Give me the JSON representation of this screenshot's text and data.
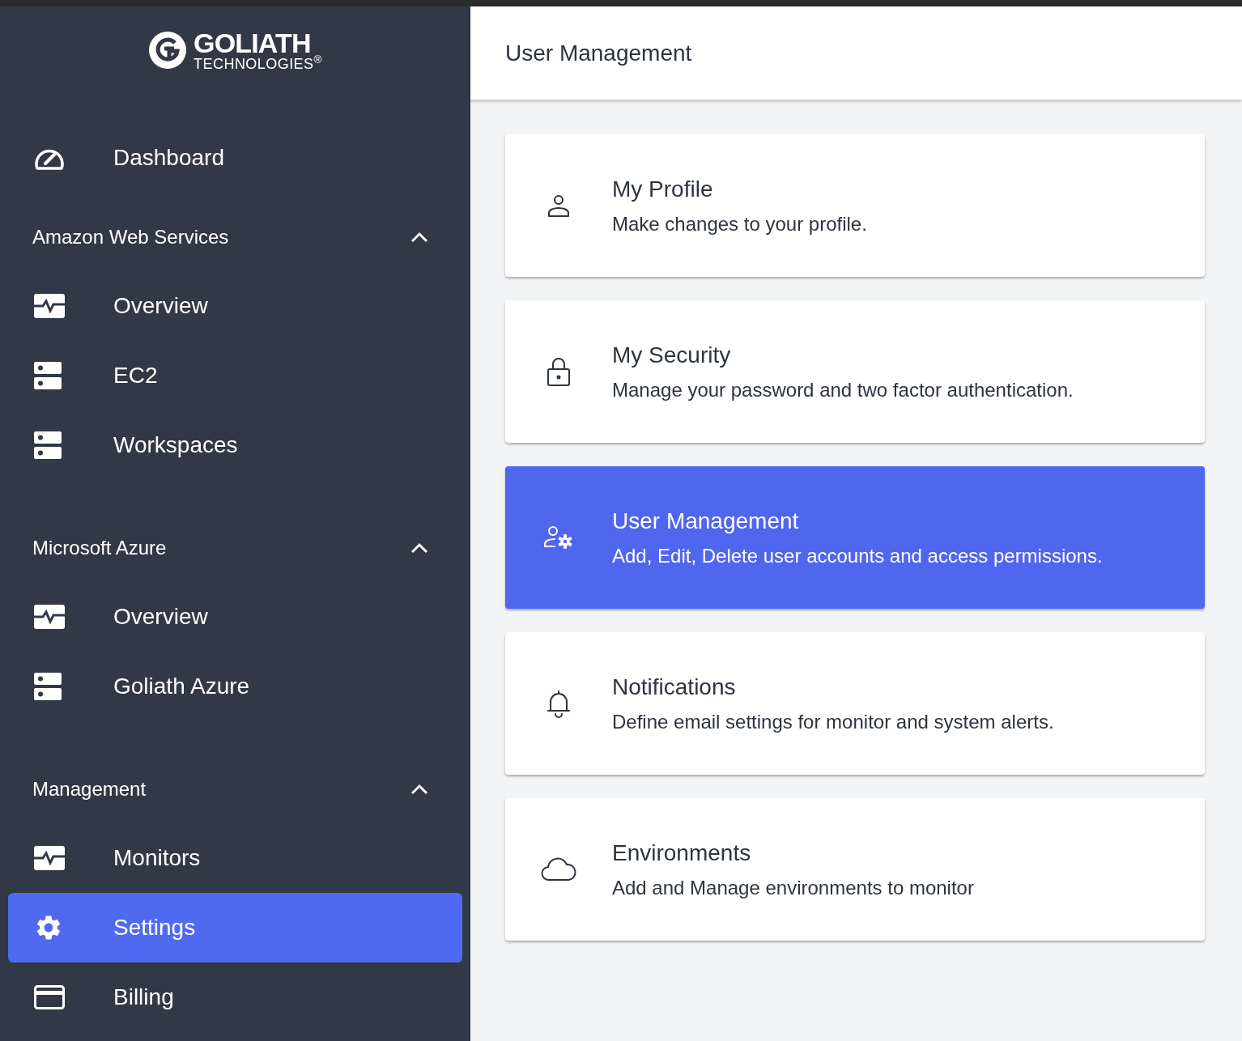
{
  "logo": {
    "name": "GOLIATH",
    "subtitle": "TECHNOLOGIES$^{®}$"
  },
  "sidebar": {
    "top_items": [
      {
        "label": "Dashboard",
        "kind": "gauge",
        "selected": false
      }
    ],
    "sections": [
      {
        "title": "Amazon Web Services",
        "expanded": true,
        "items": [
          {
            "label": "Overview",
            "kind": "pulse",
            "selected": false
          },
          {
            "label": "EC2",
            "kind": "server",
            "selected": false
          },
          {
            "label": "Workspaces",
            "kind": "server",
            "selected": false
          }
        ]
      },
      {
        "title": "Microsoft Azure",
        "expanded": true,
        "items": [
          {
            "label": "Overview",
            "kind": "pulse",
            "selected": false
          },
          {
            "label": "Goliath Azure",
            "kind": "server",
            "selected": false
          }
        ]
      },
      {
        "title": "Management",
        "expanded": true,
        "items": [
          {
            "label": "Monitors",
            "kind": "pulse",
            "selected": false
          },
          {
            "label": "Settings",
            "kind": "gear",
            "selected": true
          },
          {
            "label": "Billing",
            "kind": "card",
            "selected": false
          }
        ]
      }
    ]
  },
  "header": {
    "title": "User Management"
  },
  "cards": [
    {
      "title": "My Profile",
      "description": "Make changes to your profile.",
      "kind": "person",
      "selected": false
    },
    {
      "title": "My Security",
      "description": "Manage your password and two factor authentication.",
      "kind": "lock",
      "selected": false
    },
    {
      "title": "User Management",
      "description": "Add, Edit, Delete user accounts and access permissions.",
      "kind": "user-gear",
      "selected": true
    },
    {
      "title": "Notifications",
      "description": "Define email settings for monitor and system alerts.",
      "kind": "bell",
      "selected": false
    },
    {
      "title": "Environments",
      "description": "Add and Manage environments to monitor",
      "kind": "cloud",
      "selected": false
    }
  ]
}
